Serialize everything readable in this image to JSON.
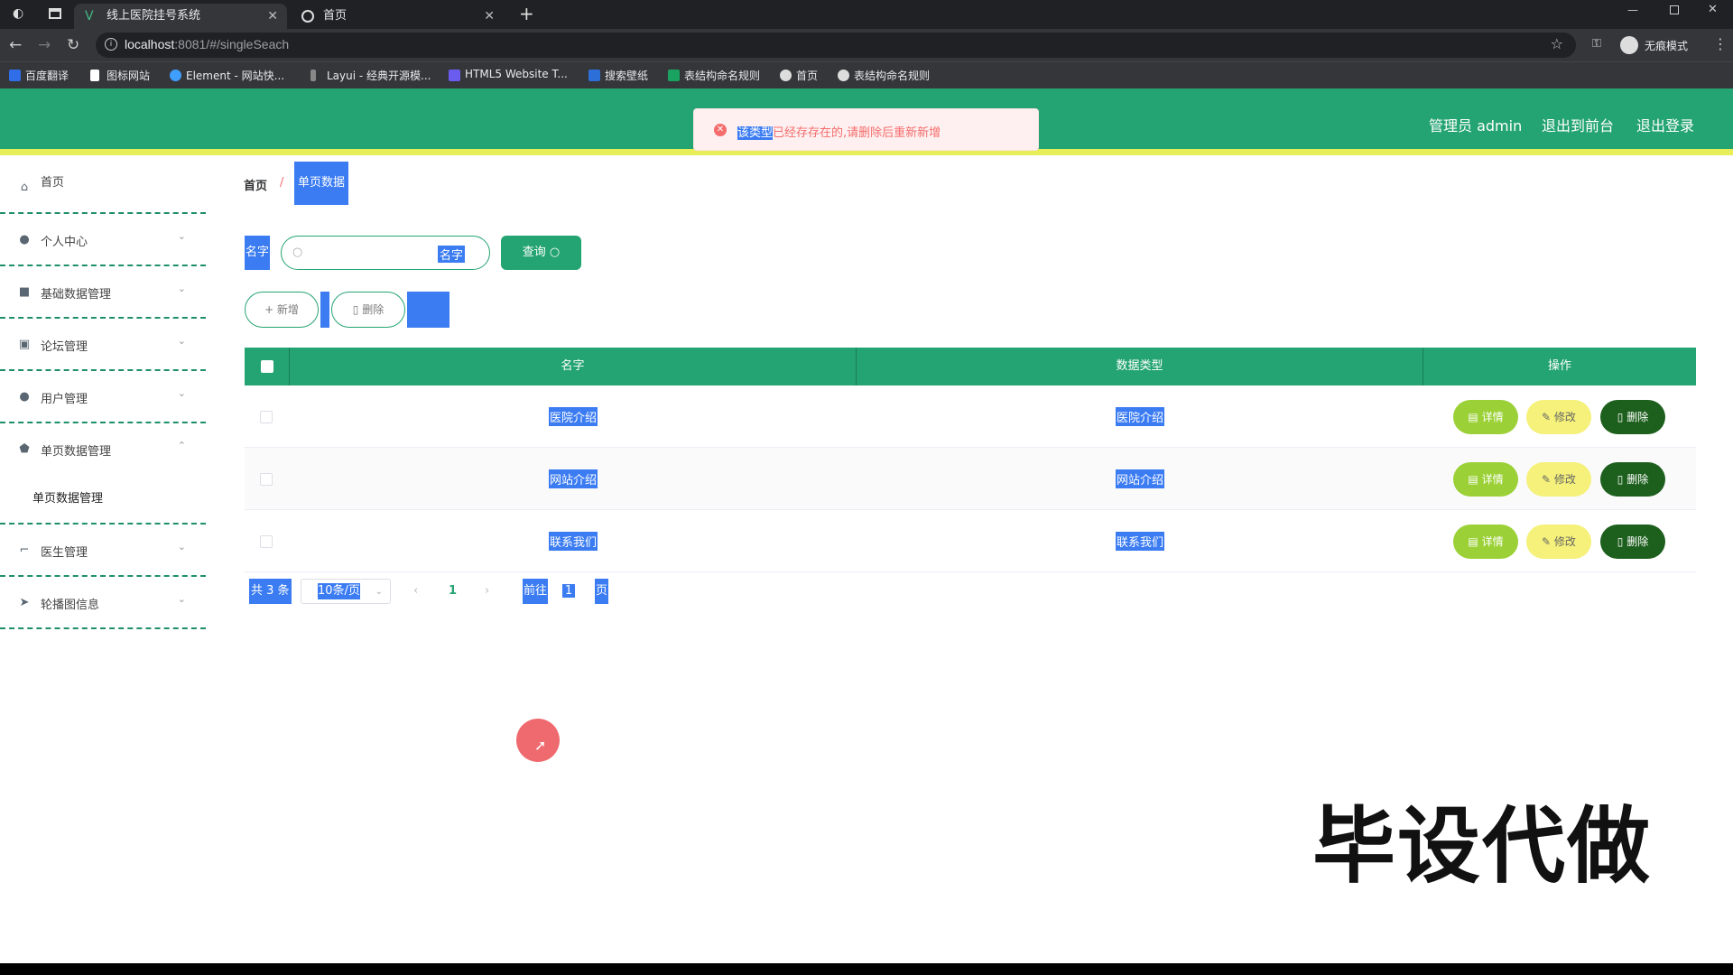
{
  "browser": {
    "tabs": [
      {
        "title": "线上医院挂号系统"
      },
      {
        "title": "首页"
      }
    ],
    "new_tab": "+",
    "url_host": "localhost",
    "url_rest": ":8081/#/singleSeach",
    "incognito_label": "无痕模式",
    "bookmarks": [
      "百度翻译",
      "图标网站",
      "Element - 网站快...",
      "Layui - 经典开源模...",
      "HTML5 Website T...",
      "搜索壁纸",
      "表结构命名规则",
      "首页",
      "表结构命名规则"
    ]
  },
  "header": {
    "admin": "管理员 admin",
    "to_front": "退出到前台",
    "logout": "退出登录"
  },
  "alert": {
    "highlight": "该类型",
    "message": "已经存存在的,请删除后重新新增"
  },
  "sidebar": {
    "items": [
      {
        "label": "首页"
      },
      {
        "label": "个人中心"
      },
      {
        "label": "基础数据管理"
      },
      {
        "label": "论坛管理"
      },
      {
        "label": "用户管理"
      },
      {
        "label": "单页数据管理"
      },
      {
        "label": "医生管理"
      },
      {
        "label": "轮播图信息"
      }
    ],
    "sub_item": "单页数据管理"
  },
  "breadcrumb": {
    "home": "首页",
    "sep": "/",
    "current": "单页数据"
  },
  "search": {
    "label": "名字",
    "placeholder": "名字",
    "query_btn": "查询 ○"
  },
  "actions": {
    "add": "+ 新增",
    "delete": "删除"
  },
  "table": {
    "headers": [
      "名字",
      "数据类型",
      "操作"
    ],
    "rows": [
      {
        "name": "医院介绍",
        "type": "医院介绍"
      },
      {
        "name": "网站介绍",
        "type": "网站介绍"
      },
      {
        "name": "联系我们",
        "type": "联系我们"
      }
    ],
    "btn_detail": "详情",
    "btn_edit": "修改",
    "btn_delete": "删除"
  },
  "pagination": {
    "total": "共 3 条",
    "page_size": "10条/页",
    "page": "1",
    "goto": "前往",
    "goto_value": "1",
    "page_unit": "页"
  },
  "watermark": "毕设代做",
  "colors": {
    "primary": "#24a472",
    "highlight": "#3b7cf2",
    "accent_bar": "#e8ee57",
    "danger": "#f56c6c"
  }
}
